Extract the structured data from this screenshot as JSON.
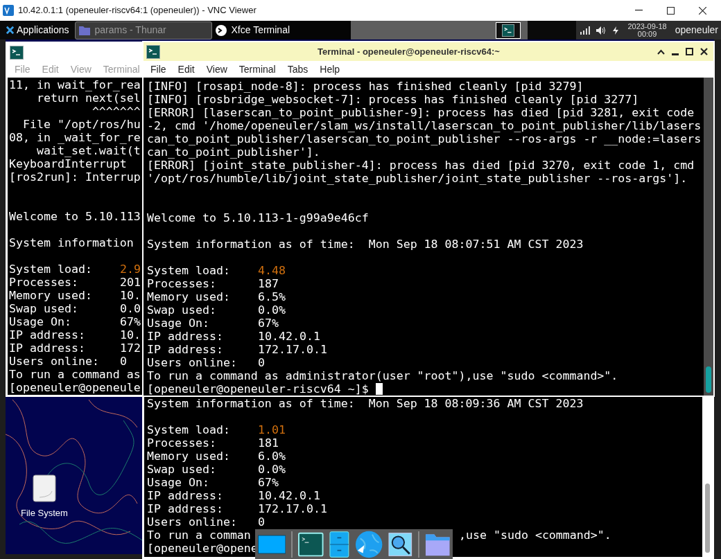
{
  "vnc_window": {
    "title": "10.42.0.1:1 (openeuler-riscv64:1 (openeuler)) - VNC Viewer"
  },
  "panel": {
    "applications": "Applications",
    "tasks": [
      {
        "label": "params - Thunar",
        "kind": "folder",
        "selected": false
      },
      {
        "label": "Xfce Terminal",
        "kind": "terminal",
        "selected": true
      }
    ],
    "clock": {
      "date": "2023-09-18",
      "time": "00:09"
    },
    "user": "openeuler"
  },
  "desktop": {
    "icons": [
      {
        "label": "File System"
      }
    ]
  },
  "back_terminal": {
    "menu": [
      "File",
      "Edit",
      "View",
      "Terminal"
    ],
    "lines": [
      {
        "kind": "text",
        "text": "11, in wait_for_rea"
      },
      {
        "kind": "text",
        "text": "    return next(sel"
      },
      {
        "kind": "text",
        "text": "            ^^^^^^^"
      },
      {
        "kind": "text",
        "text": "  File \"/opt/ros/hu"
      },
      {
        "kind": "text",
        "text": "08, in _wait_for_re"
      },
      {
        "kind": "text",
        "text": "    wait_set.wait(t"
      },
      {
        "kind": "text",
        "text": "KeyboardInterrupt"
      },
      {
        "kind": "text",
        "text": "[ros2run]: Interrup"
      },
      {
        "kind": "blank"
      },
      {
        "kind": "blank"
      },
      {
        "kind": "text",
        "text": "Welcome to 5.10.113"
      },
      {
        "kind": "blank"
      },
      {
        "kind": "text",
        "text": "System information"
      },
      {
        "kind": "blank"
      },
      {
        "kind": "stat",
        "label": "System load:",
        "value": "2.9",
        "warn": true
      },
      {
        "kind": "stat",
        "label": "Processes:",
        "value": "201",
        "warn": false
      },
      {
        "kind": "stat",
        "label": "Memory used:",
        "value": "10.",
        "warn": false
      },
      {
        "kind": "stat",
        "label": "Swap used:",
        "value": "0.0",
        "warn": false
      },
      {
        "kind": "stat",
        "label": "Usage On:",
        "value": "67%",
        "warn": false
      },
      {
        "kind": "stat",
        "label": "IP address:",
        "value": "10.",
        "warn": false
      },
      {
        "kind": "stat",
        "label": "IP address:",
        "value": "172",
        "warn": false
      },
      {
        "kind": "stat",
        "label": "Users online:",
        "value": "0",
        "warn": false
      },
      {
        "kind": "text",
        "text": "To run a command as"
      },
      {
        "kind": "text",
        "text": "[openeuler@openeule"
      }
    ]
  },
  "front_terminal": {
    "title": "Terminal - openeuler@openeuler-riscv64:~",
    "menu": [
      "File",
      "Edit",
      "View",
      "Terminal",
      "Tabs",
      "Help"
    ],
    "lines": [
      {
        "kind": "text",
        "text": "[INFO] [rosapi_node-8]: process has finished cleanly [pid 3279]"
      },
      {
        "kind": "text",
        "text": "[INFO] [rosbridge_websocket-7]: process has finished cleanly [pid 3277]"
      },
      {
        "kind": "text",
        "text": "[ERROR] [laserscan_to_point_publisher-9]: process has died [pid 3281, exit code"
      },
      {
        "kind": "text",
        "text": "-2, cmd '/home/openeuler/slam_ws/install/laserscan_to_point_publisher/lib/lasers"
      },
      {
        "kind": "text",
        "text": "can_to_point_publisher/laserscan_to_point_publisher --ros-args -r __node:=lasers"
      },
      {
        "kind": "text",
        "text": "can_to_point_publisher']."
      },
      {
        "kind": "text",
        "text": "[ERROR] [joint_state_publisher-4]: process has died [pid 3270, exit code 1, cmd"
      },
      {
        "kind": "text",
        "text": "'/opt/ros/humble/lib/joint_state_publisher/joint_state_publisher --ros-args']."
      },
      {
        "kind": "blank"
      },
      {
        "kind": "blank"
      },
      {
        "kind": "text",
        "text": "Welcome to 5.10.113-1-g99a9e46cf"
      },
      {
        "kind": "blank"
      },
      {
        "kind": "text",
        "text": "System information as of time:  Mon Sep 18 08:07:51 AM CST 2023"
      },
      {
        "kind": "blank"
      },
      {
        "kind": "stat",
        "label": "System load:",
        "value": "4.48",
        "warn": true
      },
      {
        "kind": "stat",
        "label": "Processes:",
        "value": "187",
        "warn": false
      },
      {
        "kind": "stat",
        "label": "Memory used:",
        "value": "6.5%",
        "warn": false
      },
      {
        "kind": "stat",
        "label": "Swap used:",
        "value": "0.0%",
        "warn": false
      },
      {
        "kind": "stat",
        "label": "Usage On:",
        "value": "67%",
        "warn": false
      },
      {
        "kind": "stat",
        "label": "IP address:",
        "value": "10.42.0.1",
        "warn": false
      },
      {
        "kind": "stat",
        "label": "IP address:",
        "value": "172.17.0.1",
        "warn": false
      },
      {
        "kind": "stat",
        "label": "Users online:",
        "value": "0",
        "warn": false
      },
      {
        "kind": "text",
        "text": "To run a command as administrator(user \"root\"),use \"sudo <command>\"."
      },
      {
        "kind": "prompt",
        "text": "[openeuler@openeuler-riscv64 ~]$ "
      }
    ]
  },
  "bottom_terminal": {
    "lines": [
      {
        "kind": "text",
        "text": "System information as of time:  Mon Sep 18 08:09:36 AM CST 2023"
      },
      {
        "kind": "blank"
      },
      {
        "kind": "stat",
        "label": "System load:",
        "value": "1.01",
        "warn": true
      },
      {
        "kind": "stat",
        "label": "Processes:",
        "value": "181",
        "warn": false
      },
      {
        "kind": "stat",
        "label": "Memory used:",
        "value": "6.0%",
        "warn": false
      },
      {
        "kind": "stat",
        "label": "Swap used:",
        "value": "0.0%",
        "warn": false
      },
      {
        "kind": "stat",
        "label": "Usage On:",
        "value": "67%",
        "warn": false
      },
      {
        "kind": "stat",
        "label": "IP address:",
        "value": "10.42.0.1",
        "warn": false
      },
      {
        "kind": "stat",
        "label": "IP address:",
        "value": "172.17.0.1",
        "warn": false
      },
      {
        "kind": "stat",
        "label": "Users online:",
        "value": "0",
        "warn": false
      },
      {
        "kind": "split",
        "left": "To run a comman",
        "right": ",use \"sudo <command>\"."
      },
      {
        "kind": "text",
        "text": "[openeuler@opene"
      }
    ]
  }
}
